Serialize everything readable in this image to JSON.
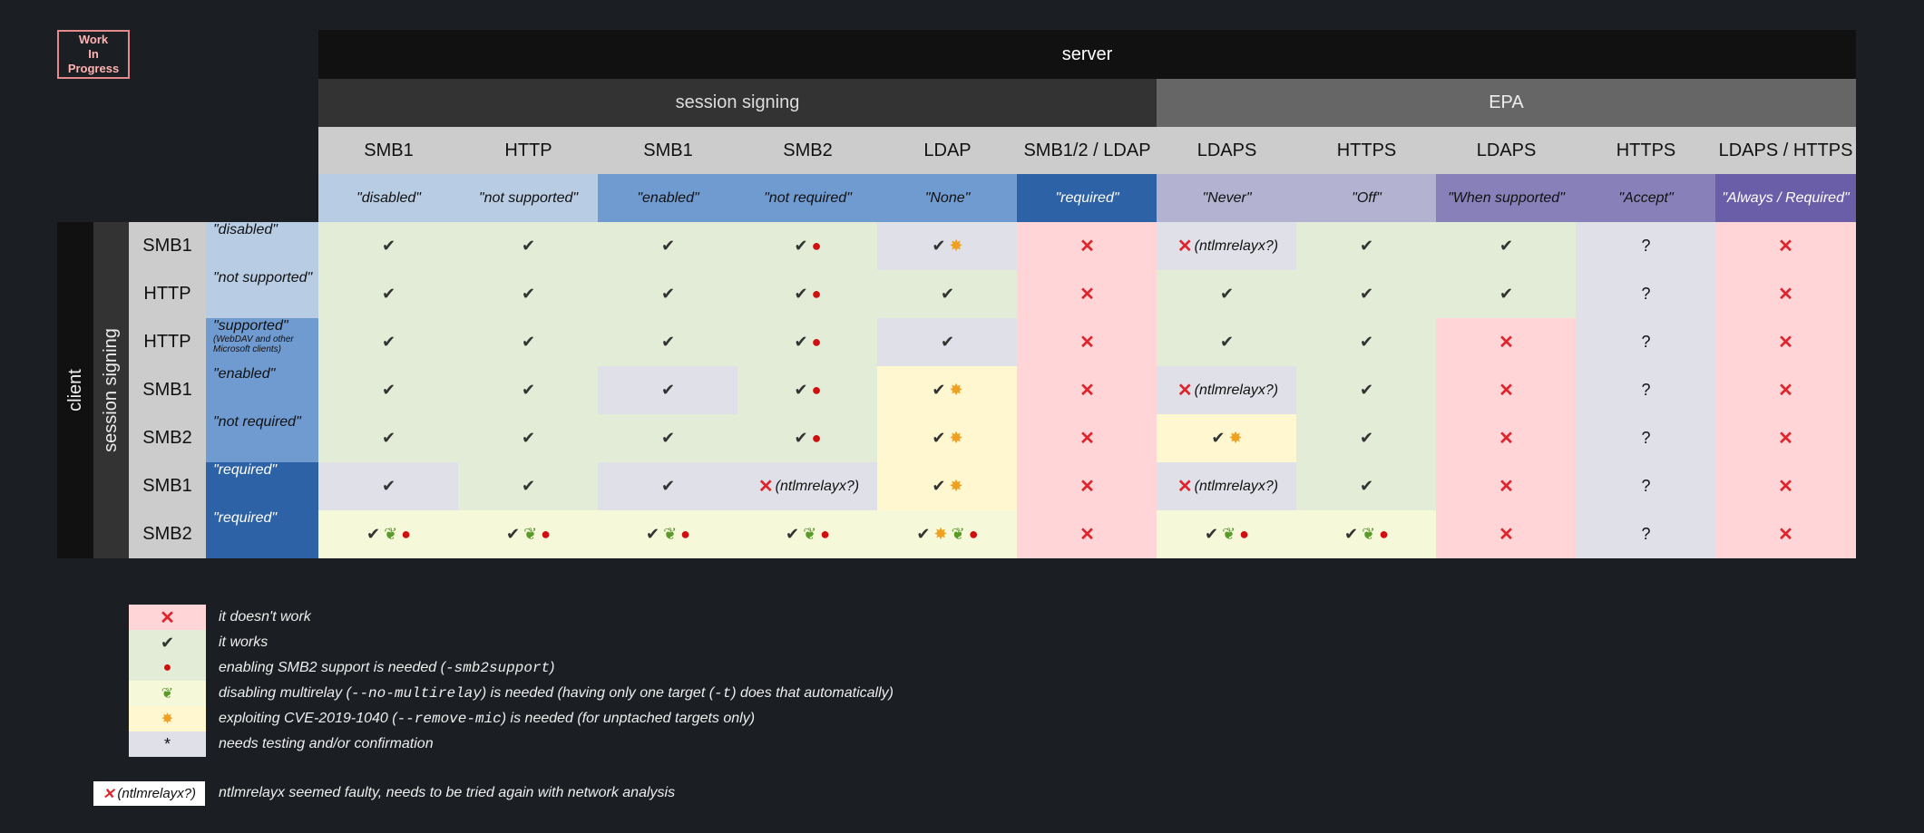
{
  "badge": {
    "line1": "Work",
    "line2": "In",
    "line3": "Progress"
  },
  "header": {
    "server": "server",
    "session_signing": "session signing",
    "epa": "EPA",
    "client": "client",
    "client_session_signing": "session signing"
  },
  "columns": [
    {
      "proto": "SMB1",
      "value": "\"disabled\""
    },
    {
      "proto": "HTTP",
      "value": "\"not supported\""
    },
    {
      "proto": "SMB1",
      "value": "\"enabled\""
    },
    {
      "proto": "SMB2",
      "value": "\"not required\""
    },
    {
      "proto": "LDAP",
      "value": "\"None\""
    },
    {
      "proto": "SMB1/2 / LDAP",
      "value": "\"required\""
    },
    {
      "proto": "LDAPS",
      "value": "\"Never\""
    },
    {
      "proto": "HTTPS",
      "value": "\"Off\""
    },
    {
      "proto": "LDAPS",
      "value": "\"When supported\""
    },
    {
      "proto": "HTTPS",
      "value": "\"Accept\""
    },
    {
      "proto": "LDAPS / HTTPS",
      "value": "\"Always / Required\""
    }
  ],
  "rows": [
    {
      "proto": "SMB1",
      "value": "\"disabled\"",
      "sub": ""
    },
    {
      "proto": "HTTP",
      "value": "\"not supported\"",
      "sub": ""
    },
    {
      "proto": "HTTP",
      "value": "\"supported\"",
      "sub": "(WebDAV and other Microsoft clients)"
    },
    {
      "proto": "SMB1",
      "value": "\"enabled\"",
      "sub": ""
    },
    {
      "proto": "SMB2",
      "value": "\"not required\"",
      "sub": ""
    },
    {
      "proto": "SMB1",
      "value": "\"required\"",
      "sub": ""
    },
    {
      "proto": "SMB2",
      "value": "\"required\"",
      "sub": ""
    }
  ],
  "colors": {
    "green": "#e2ecd6",
    "red": "#ffd5d8",
    "grey": "#e0e0e8",
    "yellow": "#fff7d0",
    "lightyellow": "#f5f9d9"
  },
  "cells": [
    [
      [
        "green",
        "ck"
      ],
      [
        "green",
        "ck"
      ],
      [
        "green",
        "ck"
      ],
      [
        "green",
        "ck apple"
      ],
      [
        "grey",
        "ck boom"
      ],
      [
        "red",
        "x"
      ],
      [
        "grey",
        "x ntlm"
      ],
      [
        "green",
        "ck"
      ],
      [
        "green",
        "ck"
      ],
      [
        "grey",
        "q"
      ],
      [
        "red",
        "x"
      ]
    ],
    [
      [
        "green",
        "ck"
      ],
      [
        "green",
        "ck"
      ],
      [
        "green",
        "ck"
      ],
      [
        "green",
        "ck apple"
      ],
      [
        "green",
        "ck"
      ],
      [
        "red",
        "x"
      ],
      [
        "green",
        "ck"
      ],
      [
        "green",
        "ck"
      ],
      [
        "green",
        "ck"
      ],
      [
        "grey",
        "q"
      ],
      [
        "red",
        "x"
      ]
    ],
    [
      [
        "green",
        "ck"
      ],
      [
        "green",
        "ck"
      ],
      [
        "green",
        "ck"
      ],
      [
        "green",
        "ck apple"
      ],
      [
        "grey",
        "ck"
      ],
      [
        "red",
        "x"
      ],
      [
        "green",
        "ck"
      ],
      [
        "green",
        "ck"
      ],
      [
        "red",
        "x"
      ],
      [
        "grey",
        "q"
      ],
      [
        "red",
        "x"
      ]
    ],
    [
      [
        "green",
        "ck"
      ],
      [
        "green",
        "ck"
      ],
      [
        "grey",
        "ck"
      ],
      [
        "green",
        "ck apple"
      ],
      [
        "yellow",
        "ck boom"
      ],
      [
        "red",
        "x"
      ],
      [
        "grey",
        "x ntlm"
      ],
      [
        "green",
        "ck"
      ],
      [
        "red",
        "x"
      ],
      [
        "grey",
        "q"
      ],
      [
        "red",
        "x"
      ]
    ],
    [
      [
        "green",
        "ck"
      ],
      [
        "green",
        "ck"
      ],
      [
        "green",
        "ck"
      ],
      [
        "green",
        "ck apple"
      ],
      [
        "yellow",
        "ck boom"
      ],
      [
        "red",
        "x"
      ],
      [
        "yellow",
        "ck boom"
      ],
      [
        "green",
        "ck"
      ],
      [
        "red",
        "x"
      ],
      [
        "grey",
        "q"
      ],
      [
        "red",
        "x"
      ]
    ],
    [
      [
        "grey",
        "ck"
      ],
      [
        "green",
        "ck"
      ],
      [
        "grey",
        "ck"
      ],
      [
        "grey",
        "x ntlm"
      ],
      [
        "yellow",
        "ck boom"
      ],
      [
        "red",
        "x"
      ],
      [
        "grey",
        "x ntlm"
      ],
      [
        "green",
        "ck"
      ],
      [
        "red",
        "x"
      ],
      [
        "grey",
        "q"
      ],
      [
        "red",
        "x"
      ]
    ],
    [
      [
        "lightyellow",
        "ck leaf apple"
      ],
      [
        "lightyellow",
        "ck leaf apple"
      ],
      [
        "lightyellow",
        "ck leaf apple"
      ],
      [
        "lightyellow",
        "ck leaf apple"
      ],
      [
        "lightyellow",
        "ck boom leaf apple"
      ],
      [
        "red",
        "x"
      ],
      [
        "lightyellow",
        "ck leaf apple"
      ],
      [
        "lightyellow",
        "ck leaf apple"
      ],
      [
        "red",
        "x"
      ],
      [
        "grey",
        "q"
      ],
      [
        "red",
        "x"
      ]
    ]
  ],
  "symbols": {
    "check": "✔",
    "cross": "✕",
    "apple": "●",
    "leaf": "❦",
    "boom": "✸",
    "question": "?",
    "ntlm": "(ntlmrelayx?)",
    "star": "*"
  },
  "legend": [
    {
      "color": "red",
      "symbol": "x",
      "text": "it doesn't work"
    },
    {
      "color": "green",
      "symbol": "ck",
      "text": "it works"
    },
    {
      "color": "green",
      "symbol": "apple",
      "text_pre": "enabling SMB2 support is needed (",
      "code": "-smb2support",
      "text_post": ")"
    },
    {
      "color": "lightyellow",
      "symbol": "leaf",
      "text_pre": "disabling multirelay (",
      "code": "--no-multirelay",
      "text_mid": ") is needed (having only one target (",
      "code2": "-t",
      "text_post": ") does that automatically)"
    },
    {
      "color": "yellow",
      "symbol": "boom",
      "text_pre": "exploiting CVE-2019-1040 (",
      "code": "--remove-mic",
      "text_post": ") is needed (for unptached targets only)"
    },
    {
      "color": "grey",
      "symbol": "star",
      "text": "needs testing and/or confirmation"
    }
  ],
  "footnote": {
    "badge": "(ntlmrelayx?)",
    "text": "ntlmrelayx seemed faulty, needs to be tried again with network analysis"
  }
}
